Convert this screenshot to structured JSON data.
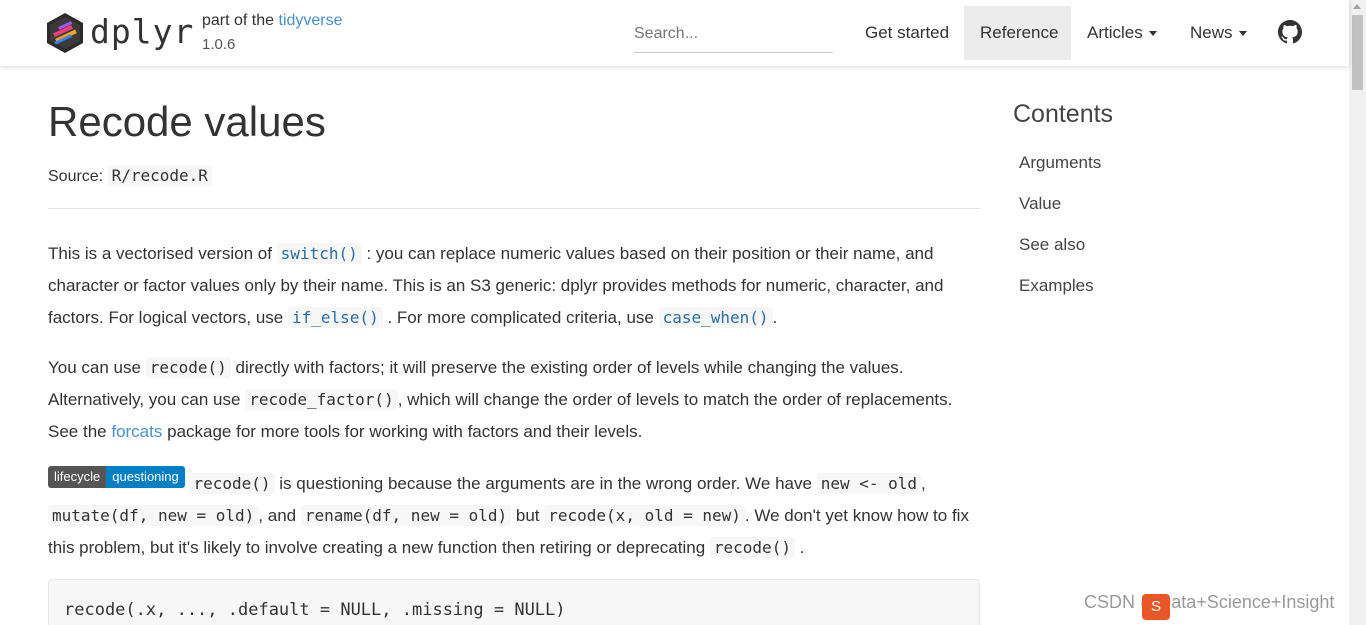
{
  "header": {
    "brand": "dplyr",
    "part_of_prefix": "part of the",
    "part_of_link": "tidyverse",
    "version": "1.0.6",
    "search_placeholder": "Search...",
    "nav": {
      "get_started": "Get started",
      "reference": "Reference",
      "articles": "Articles",
      "news": "News"
    },
    "github_icon": "github-icon"
  },
  "main": {
    "title": "Recode values",
    "source_label": "Source:",
    "source_file": "R/recode.R",
    "p1": {
      "t1": "This is a vectorised version of",
      "c1": "switch()",
      "t2": ": you can replace numeric values based on their position or their name, and character or factor values only by their name. This is an S3 generic: dplyr provides methods for numeric, character, and factors. For logical vectors, use",
      "c2": "if_else()",
      "t3": ". For more complicated criteria, use",
      "c3": "case_when()",
      "t4": "."
    },
    "p2": {
      "t1": "You can use",
      "c1": "recode()",
      "t2": "directly with factors; it will preserve the existing order of levels while changing the values. Alternatively, you can use",
      "c2": "recode_factor()",
      "t3": ", which will change the order of levels to match the order of replacements. See the",
      "link": "forcats",
      "t4": "package for more tools for working with factors and their levels."
    },
    "p3": {
      "badge_left": "lifecycle",
      "badge_right": "questioning",
      "c1": "recode()",
      "t1": "is questioning because the arguments are in the wrong order. We have",
      "c2": "new <- old",
      "t2": ",",
      "c3": "mutate(df, new = old)",
      "t3": ", and",
      "c4": "rename(df, new = old)",
      "t4": "but",
      "c5": "recode(x, old = new)",
      "t5": ". We don't yet know how to fix this problem, but it's likely to involve creating a new function then retiring or deprecating",
      "c6": "recode()",
      "t6": "."
    },
    "usage": "recode(.x, ..., .default = NULL, .missing = NULL)"
  },
  "sidebar": {
    "title": "Contents",
    "items": [
      "Arguments",
      "Value",
      "See also",
      "Examples"
    ]
  },
  "watermark": "CSDN @Data+Science+Insight",
  "colors": {
    "link": "#4a90c9",
    "badge_left": "#555555",
    "badge_right": "#007ec6",
    "active_nav": "#ececec"
  }
}
